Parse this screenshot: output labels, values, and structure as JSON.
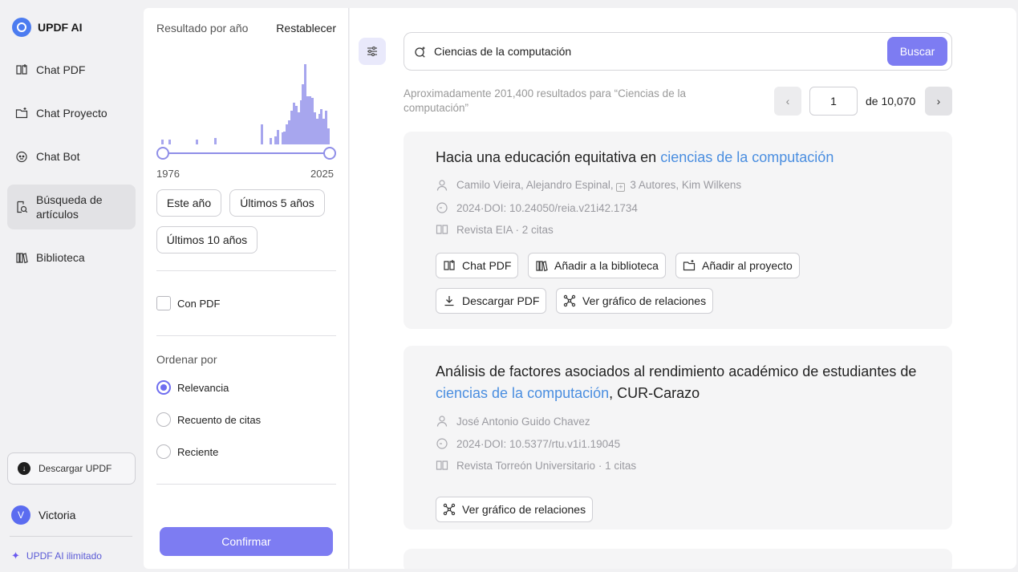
{
  "nav": {
    "brand": "UPDF AI",
    "items": [
      {
        "label": "Chat PDF",
        "icon": "book-chat-icon"
      },
      {
        "label": "Chat Proyecto",
        "icon": "folder-chat-icon"
      },
      {
        "label": "Chat Bot",
        "icon": "bot-icon"
      },
      {
        "label": "Búsqueda de artículos",
        "icon": "article-search-icon"
      },
      {
        "label": "Biblioteca",
        "icon": "library-icon"
      }
    ],
    "download_label": "Descargar UPDF",
    "user_initial": "V",
    "user_name": "Victoria",
    "unlimited_label": "UPDF AI ilimitado"
  },
  "filters": {
    "year_title": "Resultado por año",
    "reset_label": "Restablecer",
    "year_start": "1976",
    "year_end": "2025",
    "chips": [
      "Este año",
      "Últimos 5 años",
      "Últimos 10 años"
    ],
    "pdf_label": "Con PDF",
    "sort_title": "Ordenar por",
    "sort_options": [
      {
        "label": "Relevancia",
        "selected": true
      },
      {
        "label": "Recuento de citas",
        "selected": false
      },
      {
        "label": "Reciente",
        "selected": false
      }
    ],
    "confirm_label": "Confirmar",
    "histogram": [
      6,
      0,
      0,
      6,
      0,
      0,
      0,
      0,
      0,
      0,
      0,
      0,
      0,
      0,
      0,
      6,
      0,
      0,
      0,
      0,
      0,
      0,
      0,
      8,
      0,
      0,
      0,
      0,
      0,
      0,
      0,
      0,
      0,
      0,
      0,
      0,
      0,
      0,
      0,
      0,
      0,
      0,
      0,
      25,
      0,
      0,
      0,
      8,
      0,
      10,
      18,
      0,
      15,
      16,
      25,
      30,
      42,
      52,
      48,
      40,
      55,
      75,
      100,
      60,
      60,
      58,
      40,
      32,
      38,
      44,
      32,
      42,
      20
    ]
  },
  "search": {
    "value": "Ciencias de la computación",
    "button_label": "Buscar",
    "results_info": "Aproximadamente 201,400 resultados para “Ciencias de la computación”",
    "page": "1",
    "total_pages": "de 10,070"
  },
  "results": [
    {
      "title_before": "Hacia una educación equitativa en ",
      "title_highlight": "ciencias de la computación",
      "title_after": "",
      "authors": "Camilo Vieira,  Alejandro Espinal,  ",
      "more_authors": "3 Autores,",
      "last_author": "Kim Wilkens",
      "doi": "2024·DOI: 10.24050/reia.v21i42.1734",
      "journal": "Revista EIA · 2 citas",
      "actions": [
        "Chat PDF",
        "Añadir a la biblioteca",
        "Añadir al proyecto",
        "Descargar PDF",
        "Ver gráfico de relaciones"
      ]
    },
    {
      "title_before": "Análisis de factores asociados al rendimiento académico de estudiantes de ",
      "title_highlight": "ciencias de la computación",
      "title_after": ", CUR-Carazo",
      "authors": "José Antonio Guido Chavez",
      "doi": "2024·DOI: 10.5377/rtu.v1i1.19045",
      "journal": "Revista Torreón Universitario · 1 citas",
      "actions": [
        "Ver gráfico de relaciones"
      ]
    }
  ],
  "colors": {
    "accent": "#7d7cf2",
    "highlight": "#4a8ee0",
    "histogram": "#a7a6ee"
  }
}
